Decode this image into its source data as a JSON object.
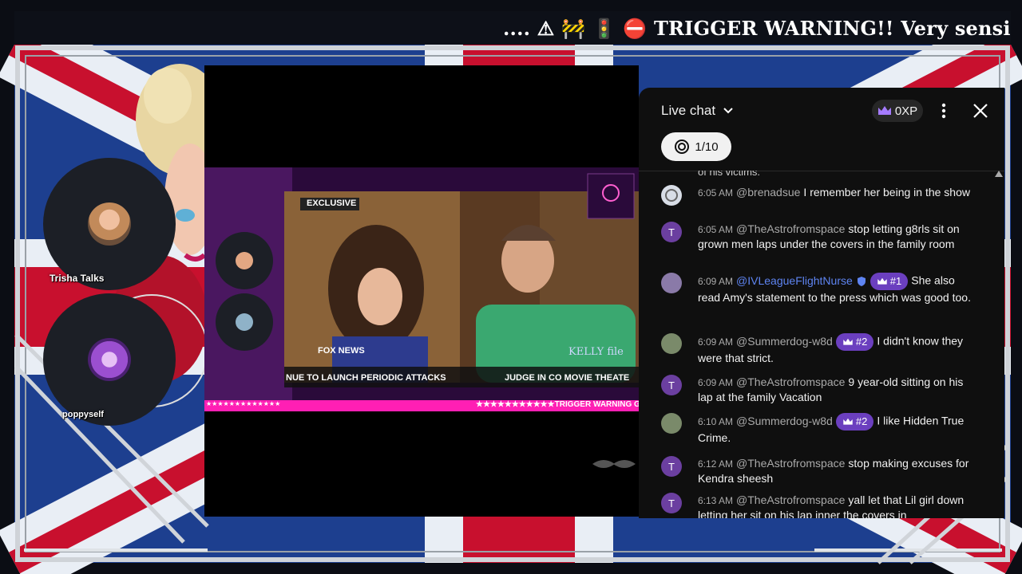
{
  "stream": {
    "ticker_text": ".... ⚠ 🚧 🚦 ⛔ TRIGGER WARNING!! Very sensitive materi",
    "guests": [
      {
        "name": "Trisha Talks"
      },
      {
        "name": "poppyself"
      }
    ],
    "video": {
      "banner_label": "EXCLUSIVE",
      "lower_third_left": "NUE TO LAUNCH PERIODIC ATTACKS",
      "lower_third_right": "JUDGE IN CO MOVIE THEATE",
      "network_logo": "FOX NEWS",
      "show_logo": "KELLY file",
      "pink_bar_left": "★★★★★★★★★★★★★",
      "pink_bar_right": "★★★★★★★★★★★TRIGGER WARNING GR"
    }
  },
  "chat": {
    "title": "Live chat",
    "xp_label": "0XP",
    "goal_chip": "1/10",
    "partial_top_text": "of his victims.",
    "messages": [
      {
        "avatar": "",
        "time": "6:05 AM",
        "author": "@brenadsue",
        "rank": "",
        "text": "I remember her being in the show"
      },
      {
        "avatar": "T",
        "time": "6:05 AM",
        "author": "@TheAstrofromspace",
        "rank": "",
        "text": "stop letting g8rls sit on grown men laps under the covers in the family room"
      },
      {
        "avatar": "",
        "time": "6:09 AM",
        "author": "@IVLeagueFlightNurse",
        "rank": "#1",
        "text": "She also read Amy's statement to the press which was good too."
      },
      {
        "avatar": "",
        "time": "6:09 AM",
        "author": "@Summerdog-w8d",
        "rank": "#2",
        "text": "I didn't know they were that strict."
      },
      {
        "avatar": "T",
        "time": "6:09 AM",
        "author": "@TheAstrofromspace",
        "rank": "",
        "text": "9 year-old sitting on his lap at the family Vacation"
      },
      {
        "avatar": "",
        "time": "6:10 AM",
        "author": "@Summerdog-w8d",
        "rank": "#2",
        "text": "I like Hidden True Crime."
      },
      {
        "avatar": "T",
        "time": "6:12 AM",
        "author": "@TheAstrofromspace",
        "rank": "",
        "text": "stop making excuses for Kendra sheesh"
      },
      {
        "avatar": "T",
        "time": "6:13 AM",
        "author": "@TheAstrofromspace",
        "rank": "",
        "text": "yall let that Lil girl down letting her sit on his lap inner the covers in"
      }
    ]
  },
  "colors": {
    "chat_bg": "#0f0f0f",
    "rank_badge": "#6b3fbf",
    "mod_name": "#5e84f1",
    "pink_bar": "#ff1fb4",
    "flag_red": "#c8102e",
    "flag_blue": "#012169"
  }
}
